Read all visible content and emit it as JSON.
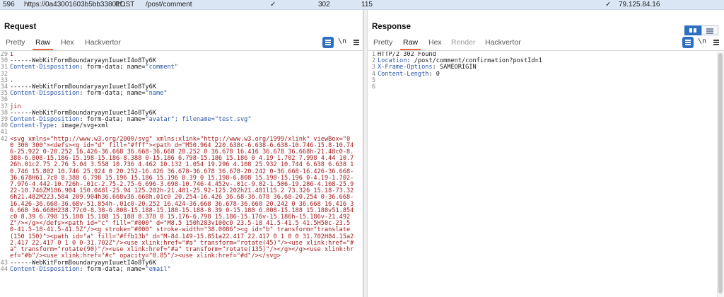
{
  "history_row": {
    "id": "596",
    "host": "https://0a43001603b5bb33801f...",
    "method": "POST",
    "path": "/post/comment",
    "check1": "✓",
    "status": "302",
    "length": "115",
    "check2": "✓",
    "ip": "79.125.84.16"
  },
  "request": {
    "title": "Request",
    "tabs": [
      {
        "label": "Pretty"
      },
      {
        "label": "Raw"
      },
      {
        "label": "Hex"
      },
      {
        "label": "Hackvertor"
      }
    ],
    "newline_label": "\\n",
    "lines": [
      {
        "n": "29",
        "t": "i",
        "c": "v"
      },
      {
        "n": "30",
        "t": "------WebKitFormBoundaryaynIuuetI4o8Ty6K",
        "c": "p"
      },
      {
        "n": "31",
        "k": "Content-Disposition",
        "t": ": form-data; name=",
        "q": "\"comment\""
      },
      {
        "n": "32",
        "t": "",
        "c": "p"
      },
      {
        "n": "33",
        "t": ".",
        "c": "v"
      },
      {
        "n": "34",
        "t": "------WebKitFormBoundaryaynIuuetI4o8Ty6K",
        "c": "p"
      },
      {
        "n": "35",
        "k": "Content-Disposition",
        "t": ": form-data; name=",
        "q": "\"name\""
      },
      {
        "n": "36",
        "t": "",
        "c": "p"
      },
      {
        "n": "37",
        "t": "jin",
        "c": "v"
      },
      {
        "n": "38",
        "t": "------WebKitFormBoundaryaynIuuetI4o8Ty6K",
        "c": "p"
      },
      {
        "n": "39",
        "k": "Content-Disposition",
        "t": ": form-data; name=",
        "q": "\"avatar\"; filename=\"test.svg\""
      },
      {
        "n": "40",
        "k": "Content-Type",
        "t": ": image/svg+xml",
        "q": ""
      },
      {
        "n": "41",
        "t": "",
        "c": "p"
      },
      {
        "n": "42",
        "t": "<svg xmlns=\"http://www.w3.org/2000/svg\" xmlns:xlink=\"http://www.w3.org/1999/xlink\" viewBox=\"0 0 300 300\"><defs><g id=\"d\" fill=\"#fff\"><path d=\"M50.964 220.638c-6.638-6.638-10.746-15.8-10.746-25.922 0-20.252 16.426-36.668 36.668-36.668 20.252 0 36.678 16.416 36.678 36.668h-21.48c0-8.388-6.808-15.186-15.198-15.186-8.388 0-15.186 6.798-15.186 15.186 0 4.19 1.702 7.998 4.44 10.726h.01c2.75 2.76 5.04 3.558 10.736 4.462 10.132 1.054 19.296 4.108 25.932 10.744 6.638 6.638 10.746 15.802 10.746 25.924 0 20.252-16.426 36.678-36.678 36.678-20.242 0-36.668-16.426-36.668-36.678H61.7c0 8.388 6.798 15.196 15.186 15.196 8.39 0 15.198-6.808 15.198-15.196 0-4.19-1.702-7.976-4.442-10.726h-.01c-2.75-2.75-6.696-3.698-10.746-4.452v-.01c-9.82-1.506-19.286-4.108-25.922-10.746ZM186.904 150.048l-25.94 125.202h-21.481-25.92-125.202h21.481l15.2 73.326 15.18-73.326h21.482M223.584 209.904h36.668v36.668h.01c0 20.254-16.426 36.68-36.678 36.68-20.254 0-36.668-16.426-36.668-36.68v-51.854h-.01c0-20.252 16.424-36.668 36.678-36.668 20.242 0 36.668 16.416 36.668 36.668H238.77c0-8.38-6.808-15.188-15.188-15.188-8.39 0-15.188 6.808-15.188 15.188v51.854c0 8.39 6.798 15.188 15.188 15.188 8.378 0 15.176-6.798 15.186-15.176v-15.186h-15.186v-21.492Z\"/></g></defs><path id=\"c\" fill=\"#000\" d=\"M8.5 150h283v100c0 23.5-18 41.5-41.5 41.5H50c-23.5 0-41.5-18-41.5-41.5Z\"/><g stroke=\"#000\" stroke-width=\"38.0086\"><g id=\"b\" transform=\"translate(150 150)\"><path id=\"a\" fill=\"#ffb13b\" d=\"M-84.149-15.851a22.417 22.417 0 1 0 0 31.702H84.15a22.417 22.417 0 1 0 0-31.702Z\"/><use xlink:href=\"#a\" transform=\"rotate(45)\"/><use xlink:href=\"#a\" transform=\"rotate(90)\"/><use xlink:href=\"#a\" transform=\"rotate(135)\"/></g></g><use xlink:href=\"#b\"/><use xlink:href=\"#c\" opacity=\"0.85\"/><use xlink:href=\"#d\"/></svg>",
        "c": "v"
      },
      {
        "n": "43",
        "t": "------WebKitFormBoundaryaynIuuetI4o8Ty6K",
        "c": "p"
      },
      {
        "n": "44",
        "k": "Content-Disposition",
        "t": ": form-data; name=",
        "q": "\"email\""
      }
    ]
  },
  "response": {
    "title": "Response",
    "tabs": [
      {
        "label": "Pretty"
      },
      {
        "label": "Raw"
      },
      {
        "label": "Hex"
      },
      {
        "label": "Render"
      },
      {
        "label": "Hackvertor"
      }
    ],
    "newline_label": "\\n",
    "lines": [
      {
        "n": "1",
        "t": "HTTP/2 302 Found",
        "c": "p"
      },
      {
        "n": "2",
        "k": "Location",
        "t": ": /post/comment/confirmation?postId=1",
        "q": ""
      },
      {
        "n": "3",
        "k": "X-Frame-Options",
        "t": ": SAMEORIGIN",
        "q": ""
      },
      {
        "n": "4",
        "k": "Content-Length",
        "t": ": 0",
        "q": ""
      },
      {
        "n": "5",
        "t": "",
        "c": "p"
      },
      {
        "n": "6",
        "t": "",
        "c": "p"
      }
    ]
  },
  "colors": {
    "accent": "#2f6fc2",
    "tab_underline": "#e8663c",
    "header_key": "#2a55a8",
    "value": "#a51d1d"
  }
}
